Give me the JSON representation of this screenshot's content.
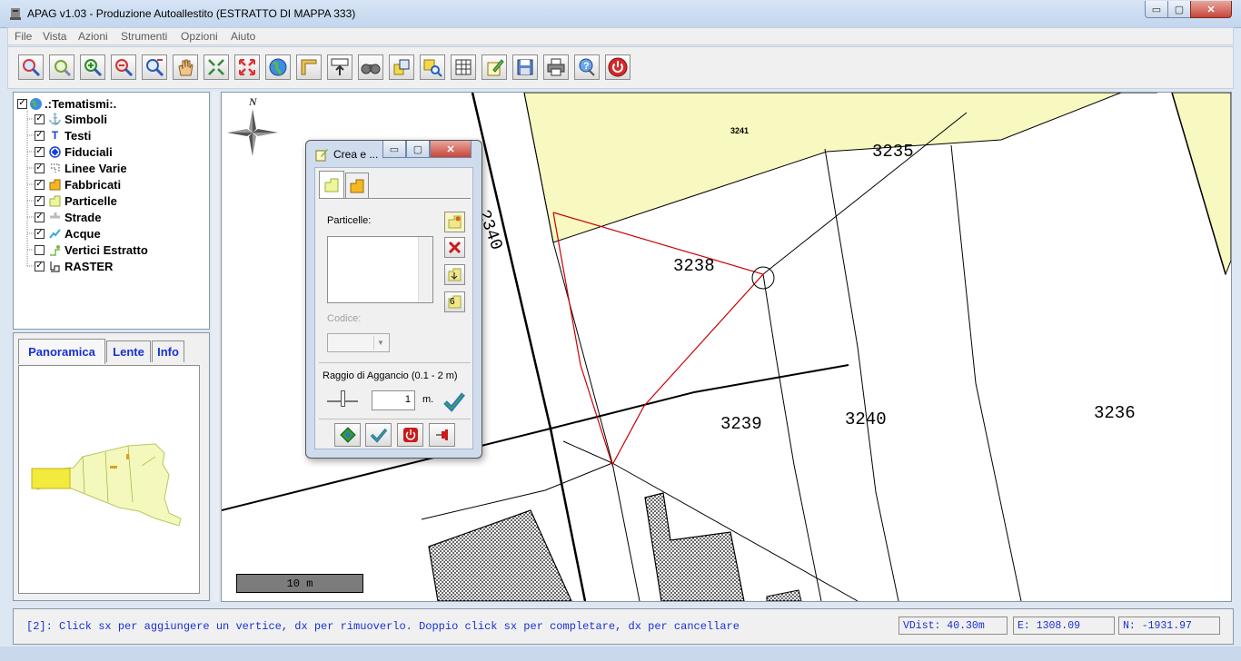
{
  "window": {
    "title": "APAG v1.03 - Produzione Autoallestito (ESTRATTO DI MAPPA 333)",
    "controls": {
      "minimize": "▭",
      "maximize": "▢",
      "close": "✕"
    }
  },
  "menu": [
    "File",
    "Vista",
    "Azioni",
    "Strumenti",
    "Opzioni",
    "Aiuto"
  ],
  "toolbar": {
    "buttons": [
      "zoom-icon",
      "zoom-window-icon",
      "zoom-in-icon",
      "zoom-out-icon",
      "zoom-extent-icon",
      "pan-hand-icon",
      "fit-all-icon",
      "expand-icon",
      "globe-icon",
      "ruler-icon",
      "scale-icon",
      "binoculars-icon",
      "layers-icon",
      "find-icon",
      "table-icon",
      "edit-icon",
      "save-icon",
      "print-icon",
      "help-icon",
      "power-icon"
    ]
  },
  "tree": {
    "root": ".:Tematismi:.",
    "items": [
      {
        "label": "Simboli",
        "checked": true,
        "icon": "anchor-icon"
      },
      {
        "label": "Testi",
        "checked": true,
        "icon": "text-icon"
      },
      {
        "label": "Fiduciali",
        "checked": true,
        "icon": "target-icon"
      },
      {
        "label": "Linee Varie",
        "checked": true,
        "icon": "dotted-lines-icon"
      },
      {
        "label": "Fabbricati",
        "checked": true,
        "icon": "building-icon"
      },
      {
        "label": "Particelle",
        "checked": true,
        "icon": "parcel-icon"
      },
      {
        "label": "Strade",
        "checked": true,
        "icon": "road-icon"
      },
      {
        "label": "Acque",
        "checked": true,
        "icon": "water-icon"
      },
      {
        "label": "Vertici Estratto",
        "checked": false,
        "icon": "vertex-icon"
      },
      {
        "label": "RASTER",
        "checked": true,
        "icon": "raster-icon"
      }
    ],
    "check_mark": "✓"
  },
  "tabs": [
    "Panoramica",
    "Lente",
    "Info"
  ],
  "map": {
    "north_label": "N",
    "parcels": [
      "3241",
      "3235",
      "2340",
      "3238",
      "3239",
      "3240",
      "3236"
    ],
    "scale_bar": "10 m"
  },
  "dialog": {
    "title": "Crea e ...",
    "particelle_label": "Particelle:",
    "codice_label": "Codice:",
    "raggio_label": "Raggio di Aggancio (0.1 - 2 m)",
    "raggio_value": "1",
    "unit": "m.",
    "folder_badge": "6",
    "controls": {
      "minimize": "▭",
      "maximize": "▢",
      "close": "✕"
    }
  },
  "status": {
    "message": "[2]: Click sx per aggiungere un vertice, dx per rimuoverlo. Doppio click sx per completare, dx per cancellare",
    "vdist": "VDist: 40.30m",
    "east": "E: 1308.09",
    "north": "N: -1931.97"
  }
}
